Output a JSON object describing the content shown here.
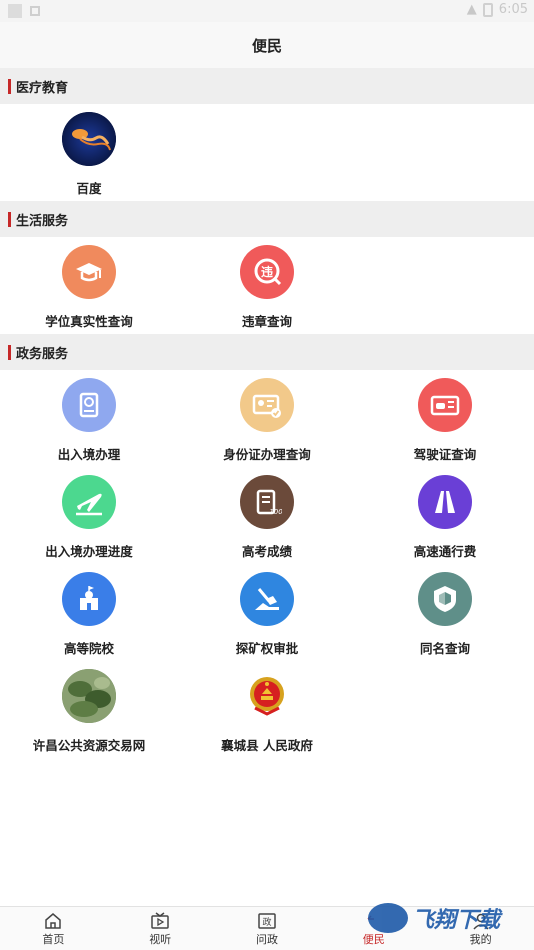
{
  "status_bar": {
    "time": "6:05"
  },
  "header": {
    "title": "便民"
  },
  "sections": [
    {
      "title": "医疗教育",
      "items": [
        {
          "label": "百度",
          "icon": "jellyfish-photo-icon"
        }
      ]
    },
    {
      "title": "生活服务",
      "items": [
        {
          "label": "学位真实性查询",
          "icon": "graduation-cap-icon",
          "color": "#f08a5d"
        },
        {
          "label": "违章查询",
          "icon": "traffic-violation-icon",
          "color": "#f05a5a"
        }
      ]
    },
    {
      "title": "政务服务",
      "items": [
        {
          "label": "出入境办理",
          "icon": "passport-icon",
          "color": "#8fa8ef"
        },
        {
          "label": "身份证办理查询",
          "icon": "id-card-icon",
          "color": "#f2c98a"
        },
        {
          "label": "驾驶证查询",
          "icon": "driver-license-icon",
          "color": "#f05a5a"
        },
        {
          "label": "出入境办理进度",
          "icon": "airplane-icon",
          "color": "#4cd88f"
        },
        {
          "label": "高考成绩",
          "icon": "exam-score-icon",
          "color": "#6b4a3a"
        },
        {
          "label": "高速通行费",
          "icon": "highway-icon",
          "color": "#6a3fd6"
        },
        {
          "label": "高等院校",
          "icon": "university-icon",
          "color": "#3a7ee8"
        },
        {
          "label": "探矿权审批",
          "icon": "mining-shovel-icon",
          "color": "#2f86e0"
        },
        {
          "label": "同名查询",
          "icon": "shield-cube-icon",
          "color": "#5f8f89"
        },
        {
          "label": "许昌公共资源交易网",
          "icon": "leaf-photo-icon"
        },
        {
          "label": "襄城县 人民政府",
          "icon": "national-emblem-icon"
        }
      ]
    }
  ],
  "tabbar": [
    {
      "label": "首页",
      "icon": "home-icon"
    },
    {
      "label": "视听",
      "icon": "tv-play-icon"
    },
    {
      "label": "问政",
      "icon": "politics-icon"
    },
    {
      "label": "便民",
      "icon": "convenience-icon",
      "active": true
    },
    {
      "label": "我的",
      "icon": "user-icon"
    }
  ],
  "watermark": {
    "text": "飞翔下载"
  }
}
